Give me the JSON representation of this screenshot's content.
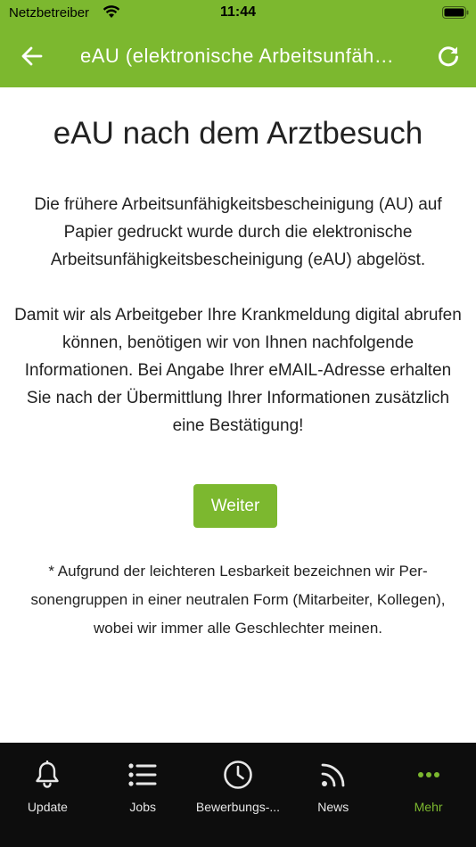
{
  "status_bar": {
    "carrier": "Netzbetreiber",
    "time": "11:44",
    "icons": [
      "wifi-icon",
      "battery-icon"
    ]
  },
  "nav": {
    "title": "eAU (elektronische Arbeitsunfähigkeitsbescheinigung)",
    "back_icon": "arrow-left-icon",
    "reload_icon": "reload-icon"
  },
  "content": {
    "heading": "eAU nach dem Arztbesuch",
    "paragraph1": "Die frühere Arbeitsunfähigkeitsbescheinigung (AU) auf Papier gedruckt wurde durch die elektronische Arbeitsunfähigkeitsbescheinigung (eAU) abgelöst.",
    "paragraph2": "Damit wir als Arbeitgeber Ihre Krankmeldung digital abrufen können, benötigen wir von Ihnen nachfolgen­de Informationen. Bei Angabe Ihrer eMAIL-Adresse erhalten Sie nach der Übermittlung Ihrer Informatio­nen zusätzlich eine Bestätigung!",
    "button_label": "Weiter",
    "footnote": "* Aufgrund der leichteren Lesbarkeit bezeichnen wir Per­sonengruppen in einer neutralen Form (Mitarbeiter, Kol­legen), wobei wir immer alle Geschlechter meinen."
  },
  "tabs": [
    {
      "label": "Update",
      "icon": "bell-icon",
      "active": false
    },
    {
      "label": "Jobs",
      "icon": "list-icon",
      "active": false
    },
    {
      "label": "Bewerbungs-...",
      "icon": "clock-icon",
      "active": false
    },
    {
      "label": "News",
      "icon": "rss-icon",
      "active": false
    },
    {
      "label": "Mehr",
      "icon": "more-dots-icon",
      "active": true
    }
  ],
  "colors": {
    "accent": "#7cb82f",
    "tab_bar_bg": "#0d0d0d",
    "text": "#222222"
  }
}
